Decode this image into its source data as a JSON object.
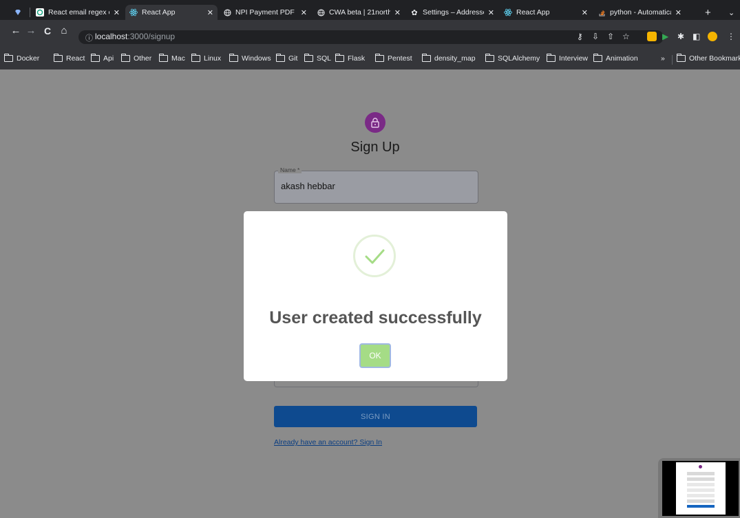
{
  "tabs": [
    {
      "title": "",
      "icon": "gem-icon",
      "pinned": true
    },
    {
      "title": "React email regex ch",
      "icon": "openai-icon"
    },
    {
      "title": "React App",
      "icon": "react-icon",
      "active": true
    },
    {
      "title": "NPI Payment PDF Pr",
      "icon": "globe-icon"
    },
    {
      "title": "CWA beta | 21north",
      "icon": "globe-icon"
    },
    {
      "title": "Settings – Addresse",
      "icon": "gear-icon"
    },
    {
      "title": "React App",
      "icon": "react-icon"
    },
    {
      "title": "python - Automatica",
      "icon": "stackoverflow-icon"
    }
  ],
  "url": {
    "host": "localhost",
    "path": ":3000/signup"
  },
  "bookmarks": [
    "Docker",
    "React",
    "Api",
    "Other",
    "Mac",
    "Linux",
    "Windows",
    "Git",
    "SQL",
    "Flask",
    "Pentest",
    "density_map",
    "SQLAlchemy",
    "Interview",
    "Animation"
  ],
  "bookmarks_overflow": "»",
  "other_bookmarks": "Other Bookmarks",
  "form": {
    "title": "Sign Up",
    "name_label": "Name *",
    "name_value": "akash hebbar",
    "submit_label": "SIGN IN",
    "signin_link": "Already have an account? Sign In"
  },
  "modal": {
    "title": "User created successfully",
    "ok_label": "OK",
    "icon": "check-icon",
    "check_color": "#a5dc86"
  },
  "colors": {
    "avatar": "#7a2a86",
    "submit": "#0e4a8f",
    "link": "#0a3d80",
    "ok": "#a5dc86"
  }
}
